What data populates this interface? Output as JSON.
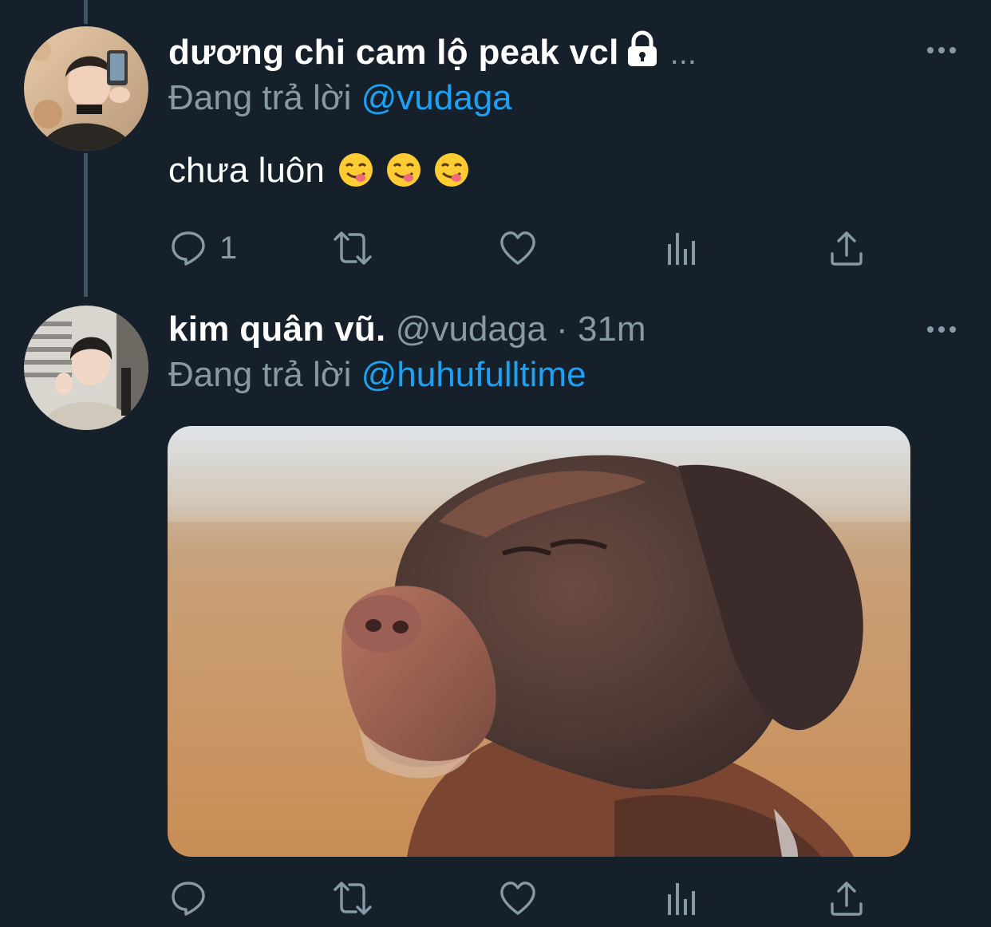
{
  "tweets": [
    {
      "display_name": "dương chi cam lộ peak vcl",
      "name_ellipsis": "...",
      "handle": "",
      "time": "",
      "protected": true,
      "reply_label": "Đang trả lời",
      "reply_to": "@vudaga",
      "text": "chưa luôn",
      "emojis": [
        "yum-face",
        "yum-face",
        "yum-face"
      ],
      "actions": {
        "reply_count": "1",
        "retweet_count": "",
        "like_count": ""
      }
    },
    {
      "display_name": "kim quân vũ.",
      "handle": "@vudaga",
      "separator": "·",
      "time": "31m",
      "reply_label": "Đang trả lời",
      "reply_to": "@huhufulltime",
      "text": "",
      "media": "dog-photo",
      "actions": {
        "reply_count": "",
        "retweet_count": "",
        "like_count": ""
      }
    }
  ],
  "icons": {
    "more": "more-horizontal-icon",
    "reply": "reply-icon",
    "retweet": "retweet-icon",
    "like": "heart-icon",
    "analytics": "analytics-icon",
    "share": "share-icon",
    "lock": "lock-icon"
  },
  "colors": {
    "background": "#15202b",
    "primary_text": "#ffffff",
    "secondary_text": "#8899a6",
    "accent": "#1da1f2",
    "thread_line": "#3d5466"
  }
}
